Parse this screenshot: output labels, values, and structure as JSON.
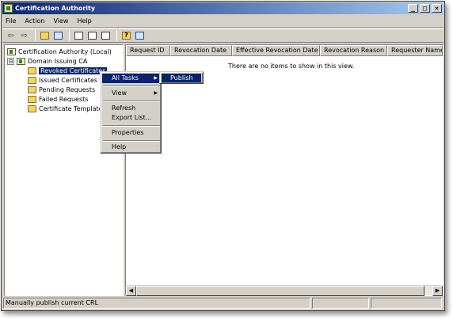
{
  "window": {
    "title": "Certification Authority"
  },
  "menubar": {
    "items": [
      "File",
      "Action",
      "View",
      "Help"
    ]
  },
  "toolbar": {
    "buttons": [
      "back-arrow-icon",
      "forward-arrow-icon",
      "up-folder-icon",
      "show-hide-tree-icon",
      "properties-icon",
      "refresh-icon",
      "export-list-icon",
      "help-icon",
      "console-icon"
    ]
  },
  "tree": {
    "root": "Certification Authority (Local)",
    "ca": "Domain Issuing CA",
    "expander": "⊟",
    "folders": [
      "Revoked Certificates",
      "Issued Certificates",
      "Pending Requests",
      "Failed Requests",
      "Certificate Templates"
    ]
  },
  "list": {
    "columns": [
      "Request ID",
      "Revocation Date",
      "Effective Revocation Date",
      "Revocation Reason",
      "Requester Name"
    ],
    "empty_message": "There are no items to show in this view."
  },
  "context_menu": {
    "items": [
      "All Tasks",
      "View",
      "Refresh",
      "Export List...",
      "Properties",
      "Help"
    ],
    "highlighted": "All Tasks"
  },
  "submenu": {
    "items": [
      "Publish"
    ]
  },
  "statusbar": {
    "text": "Manually publish current CRL"
  },
  "colors": {
    "title_start": "#0a246a",
    "title_end": "#a6caf0",
    "face": "#d4d0c8",
    "highlight": "#0a246a"
  }
}
